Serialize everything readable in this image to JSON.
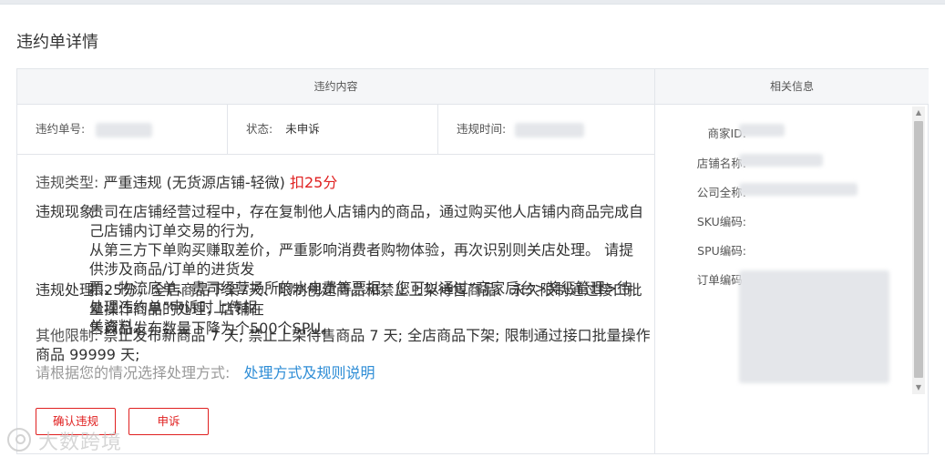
{
  "page": {
    "title": "违约单详情"
  },
  "violation": {
    "header": "违约内容",
    "order_no_label": "违约单号:",
    "status_label": "状态:",
    "status_value": "未申诉",
    "time_label": "违规时间:",
    "type_label": "违规类型:",
    "type_value": "严重违规 (无货源店铺-轻微)",
    "deduction": "扣25分",
    "phenomenon_label": "违规现象:",
    "phenomenon_lines": [
      "贵司在店铺经营过程中，存在复制他人店铺内的商品，通过购买他人店铺内商品完成自己店铺内订单交易的行为,",
      "从第三方下单购买赚取差价，严重影响消费者购物体验，再次识别则关店处理。 请提供涉及商品/订单的进货发",
      "票、物流底单、贵司经营场所的水电费等票据，您可以通过“商家后台>奖惩管理>待处理违约单”申诉时上传相",
      "关资料。"
    ],
    "handling_label": "违规处理:",
    "handling_lines": [
      "扣25分，全店商品下架7天、限制创建商品和禁止上架待售商品、永久限制通过接口批量操作商品的处理，店铺在",
      "售商品发布数量下降为个500个SPU。"
    ],
    "other_label": "其他限制:",
    "other_value": "禁止发布新商品 7 天; 禁止上架待售商品 7 天; 全店商品下架; 限制通过接口批量操作商品 99999 天;",
    "hint": "请根据您的情况选择处理方式:",
    "link": "处理方式及规则说明",
    "confirm_button": "确认违规",
    "appeal_button": "申诉"
  },
  "related": {
    "header": "相关信息",
    "merchant_id_label": "商家ID:",
    "shop_name_label": "店铺名称:",
    "company_label": "公司全称:",
    "sku_label": "SKU编码:",
    "spu_label": "SPU编码:",
    "order_code_label": "订单编码:"
  },
  "watermark": {
    "text": "大数跨境"
  },
  "icons": [
    "scroll-up-arrow-icon",
    "scroll-down-arrow-icon",
    "watermark-logo-icon"
  ],
  "colors": {
    "accent_red": "#e02020",
    "link_blue": "#2e8dd6",
    "border": "#e2e5ea",
    "header_bg": "#f5f6f8"
  }
}
